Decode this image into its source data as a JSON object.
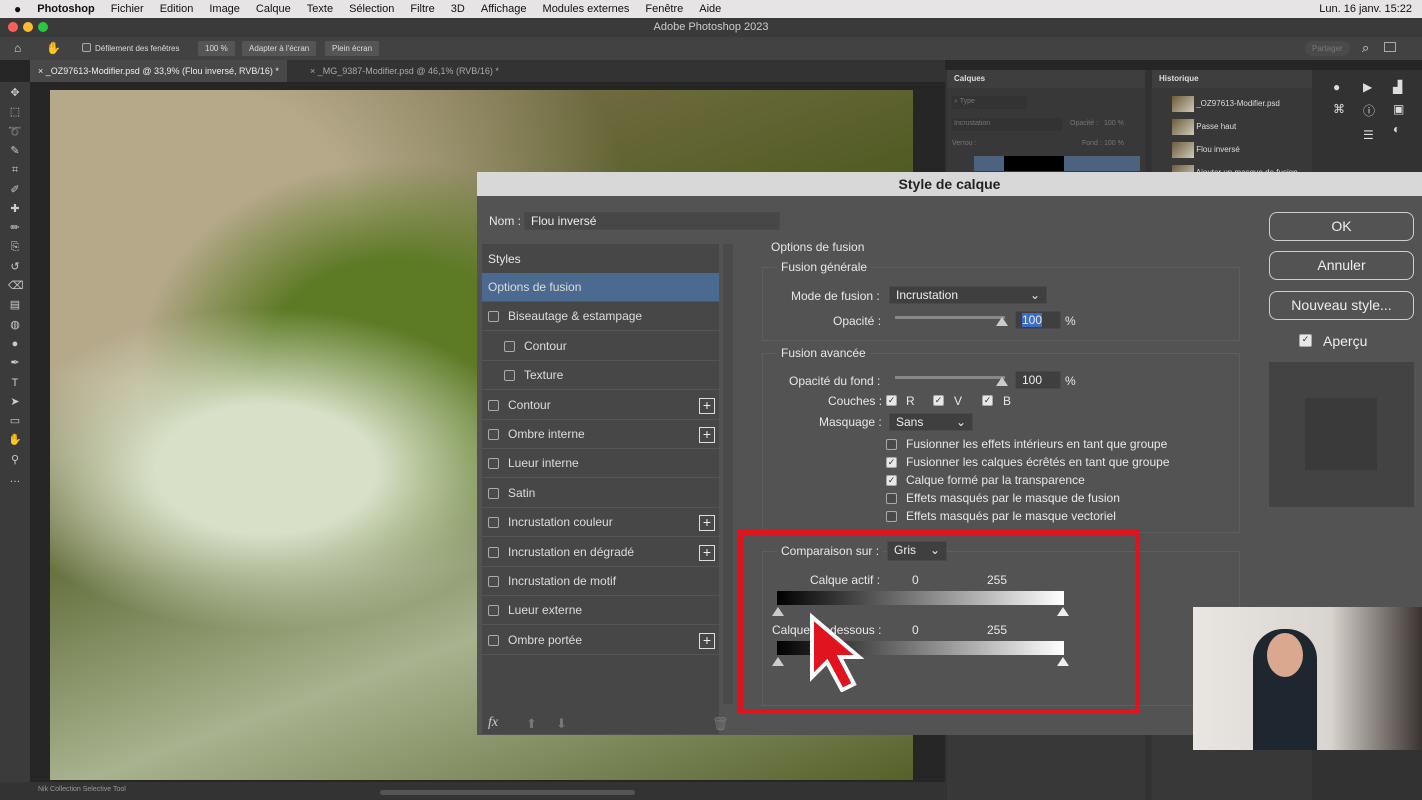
{
  "menubar": {
    "app": "Photoshop",
    "items": [
      "Fichier",
      "Edition",
      "Image",
      "Calque",
      "Texte",
      "Sélection",
      "Filtre",
      "3D",
      "Affichage",
      "Modules externes",
      "Fenêtre",
      "Aide"
    ],
    "datetime": "Lun. 16 janv.  15:22"
  },
  "window": {
    "title": "Adobe Photoshop 2023"
  },
  "options": {
    "scroll_all": "Défilement des fenêtres",
    "zoom": "100 %",
    "fit": "Adapter à l'écran",
    "full": "Plein écran",
    "share": "Partager"
  },
  "tabs": [
    {
      "label": "_OZ97613-Modifier.psd @ 33,9% (Flou inversé, RVB/16) *",
      "active": true
    },
    {
      "label": "_MG_9387-Modifier.psd @ 46,1% (RVB/16) *",
      "active": false
    }
  ],
  "layers_panel": {
    "title": "Calques",
    "search": "Type",
    "blend": "Incrustation",
    "opacity_label": "Opacité :",
    "opacity": "100 %",
    "lock_label": "Verrou :",
    "fill_label": "Fond :",
    "fill": "100 %"
  },
  "history_panel": {
    "title": "Historique",
    "items": [
      "_OZ97613-Modifier.psd",
      "Passe haut",
      "Flou inversé",
      "Ajouter un masque de fusion"
    ]
  },
  "dialog": {
    "title": "Style de calque",
    "name_label": "Nom :",
    "name_value": "Flou inversé",
    "styles_header": "Styles",
    "styles": [
      {
        "label": "Options de fusion",
        "selected": true,
        "checkbox": false,
        "plus": false,
        "indent": false
      },
      {
        "label": "Biseautage & estampage",
        "checkbox": true,
        "plus": false,
        "indent": false
      },
      {
        "label": "Contour",
        "checkbox": true,
        "plus": false,
        "indent": true
      },
      {
        "label": "Texture",
        "checkbox": true,
        "plus": false,
        "indent": true
      },
      {
        "label": "Contour",
        "checkbox": true,
        "plus": true,
        "indent": false
      },
      {
        "label": "Ombre interne",
        "checkbox": true,
        "plus": true,
        "indent": false
      },
      {
        "label": "Lueur interne",
        "checkbox": true,
        "plus": false,
        "indent": false
      },
      {
        "label": "Satin",
        "checkbox": true,
        "plus": false,
        "indent": false
      },
      {
        "label": "Incrustation couleur",
        "checkbox": true,
        "plus": true,
        "indent": false
      },
      {
        "label": "Incrustation en dégradé",
        "checkbox": true,
        "plus": true,
        "indent": false
      },
      {
        "label": "Incrustation de motif",
        "checkbox": true,
        "plus": false,
        "indent": false
      },
      {
        "label": "Lueur externe",
        "checkbox": true,
        "plus": false,
        "indent": false
      },
      {
        "label": "Ombre portée",
        "checkbox": true,
        "plus": true,
        "indent": false
      }
    ],
    "fx": "fx",
    "blend_options": "Options de fusion",
    "general": "Fusion générale",
    "mode_label": "Mode de fusion :",
    "mode_value": "Incrustation",
    "opacity_label": "Opacité :",
    "opacity_value": "100",
    "percent": "%",
    "advanced": "Fusion avancée",
    "fill_label": "Opacité du fond :",
    "fill_value": "100",
    "channels_label": "Couches :",
    "channels": [
      "R",
      "V",
      "B"
    ],
    "knockout_label": "Masquage :",
    "knockout_value": "Sans",
    "options": [
      {
        "label": "Fusionner les effets intérieurs en tant que groupe",
        "checked": false
      },
      {
        "label": "Fusionner les calques écrêtés en tant que groupe",
        "checked": true
      },
      {
        "label": "Calque formé par la transparence",
        "checked": true
      },
      {
        "label": "Effets masqués par le masque de fusion",
        "checked": false
      },
      {
        "label": "Effets masqués par le masque vectoriel",
        "checked": false
      }
    ],
    "blendif_label": "Comparaison sur :",
    "blendif_value": "Gris",
    "this_layer": "Calque actif :",
    "underlying": "Calque du dessous :",
    "min": "0",
    "max": "255",
    "ok": "OK",
    "cancel": "Annuler",
    "new_style": "Nouveau style...",
    "preview": "Aperçu",
    "highlight_color": "#e0141e"
  },
  "status": {
    "plugin": "Nik Collection Selective Tool"
  }
}
